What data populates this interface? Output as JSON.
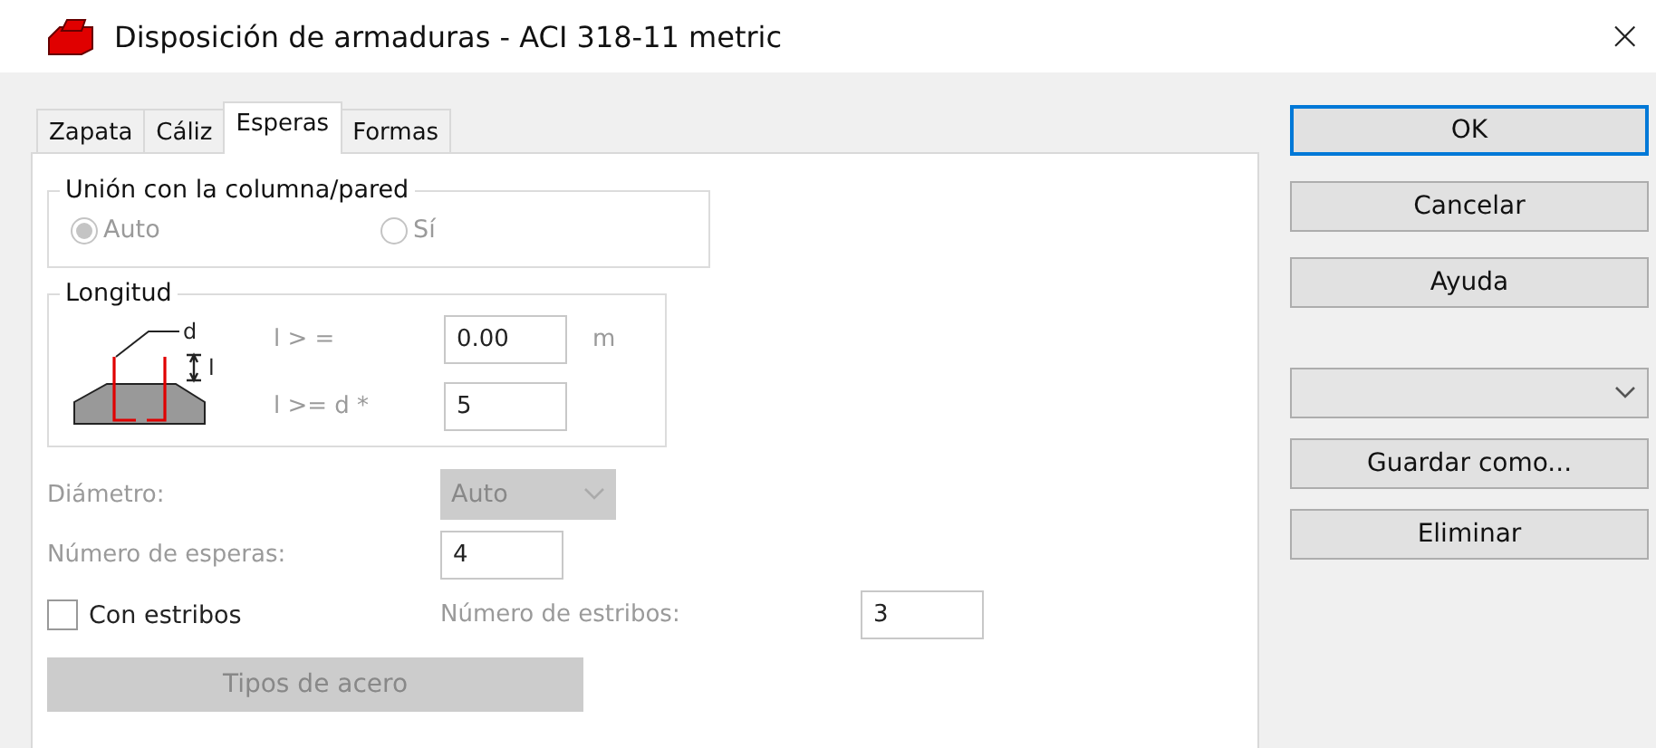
{
  "window": {
    "title": "Disposición de armaduras - ACI 318-11 metric",
    "close": "×"
  },
  "tabs": [
    {
      "label": "Zapata",
      "selected": false
    },
    {
      "label": "Cáliz",
      "selected": false
    },
    {
      "label": "Esperas",
      "selected": true
    },
    {
      "label": "Formas",
      "selected": false
    }
  ],
  "union_group": {
    "title": "Unión con la columna/pared",
    "disabled": true,
    "options": [
      {
        "label": "Auto",
        "selected": true
      },
      {
        "label": "Sí",
        "selected": false
      }
    ]
  },
  "length_group": {
    "title": "Longitud",
    "diagram_labels": {
      "d": "d",
      "l": "l"
    },
    "fields": [
      {
        "label": "l > =",
        "value": "0.00",
        "unit": "m"
      },
      {
        "label": "l >= d *",
        "value": "5"
      }
    ]
  },
  "diameter": {
    "label": "Diámetro:",
    "value": "Auto",
    "disabled": true
  },
  "bar_count": {
    "label": "Número de esperas:",
    "value": "4"
  },
  "stirrups": {
    "label": "Con estribos",
    "checked": false,
    "count_label": "Número de estribos:",
    "count_value": "3"
  },
  "steel_button": {
    "label": "Tipos de acero",
    "disabled": true
  },
  "actions": [
    {
      "kind": "button",
      "label": "OK",
      "focused": true
    },
    {
      "kind": "button",
      "label": "Cancelar",
      "focused": false
    },
    {
      "kind": "button",
      "label": "Ayuda",
      "focused": false
    },
    {
      "kind": "dropdown"
    },
    {
      "kind": "button",
      "label": "Guardar como...",
      "focused": false
    },
    {
      "kind": "button",
      "label": "Eliminar",
      "focused": false
    }
  ]
}
